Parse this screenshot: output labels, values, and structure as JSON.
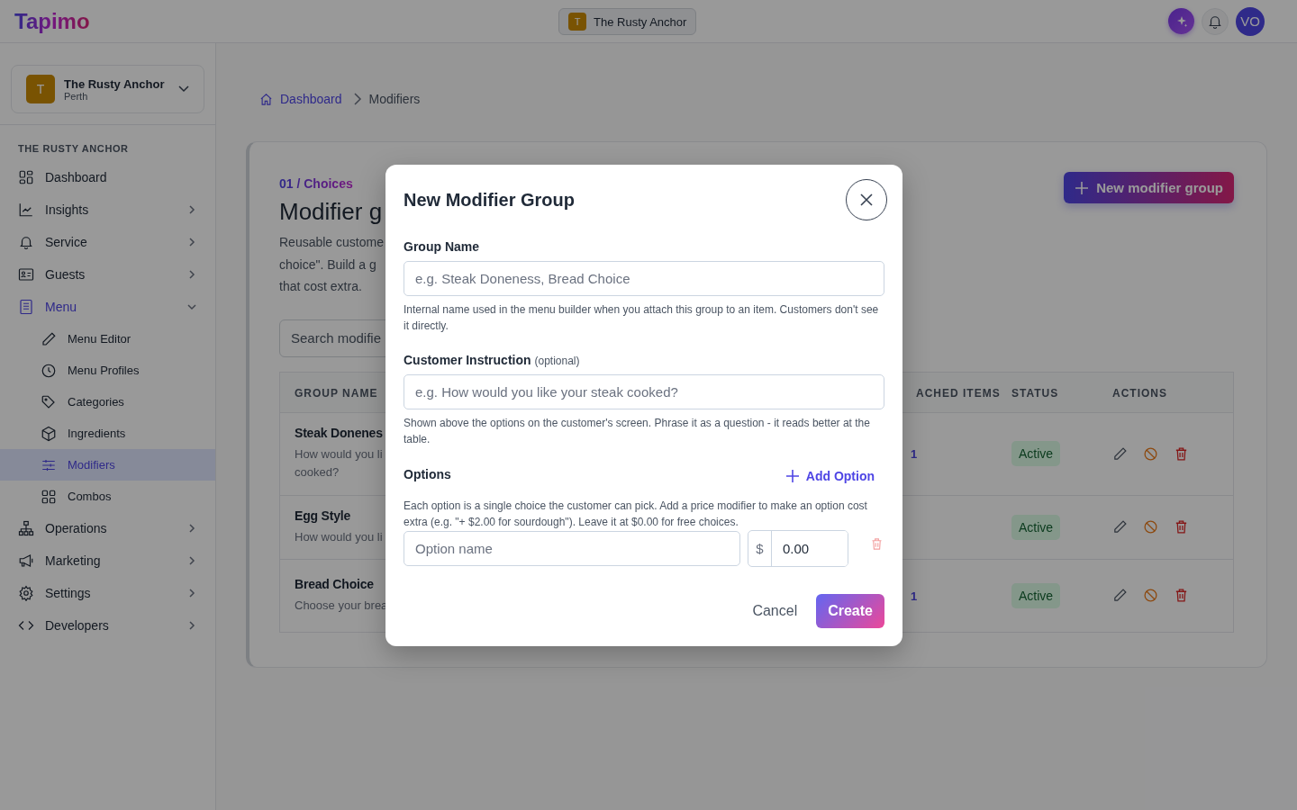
{
  "header": {
    "logo": "Tapimo",
    "venue": {
      "initial": "T",
      "name": "The Rusty Anchor"
    },
    "avatar": "VO"
  },
  "sidebar": {
    "venue": {
      "initial": "T",
      "name": "The Rusty Anchor",
      "location": "Perth"
    },
    "section": "THE RUSTY ANCHOR",
    "items": [
      {
        "label": "Dashboard",
        "selected": false
      },
      {
        "label": "Insights",
        "selected": false,
        "expanded": false
      },
      {
        "label": "Service",
        "selected": false,
        "expanded": false
      },
      {
        "label": "Guests",
        "selected": false,
        "expanded": false
      },
      {
        "label": "Menu",
        "selected": true,
        "expanded": true,
        "children": [
          {
            "label": "Menu Editor",
            "selected": false
          },
          {
            "label": "Menu Profiles",
            "selected": false
          },
          {
            "label": "Categories",
            "selected": false
          },
          {
            "label": "Ingredients",
            "selected": false
          },
          {
            "label": "Modifiers",
            "selected": true
          },
          {
            "label": "Combos",
            "selected": false
          }
        ]
      },
      {
        "label": "Operations",
        "selected": false,
        "expanded": false
      },
      {
        "label": "Marketing",
        "selected": false,
        "expanded": false
      },
      {
        "label": "Settings",
        "selected": false,
        "expanded": false
      },
      {
        "label": "Developers",
        "selected": false,
        "expanded": false
      }
    ]
  },
  "breadcrumb": [
    {
      "label": "Dashboard"
    },
    {
      "label": "Modifiers"
    }
  ],
  "page": {
    "eyebrow": "01 / Choices",
    "title": "Modifier g",
    "description_lines": [
      "Reusable custome",
      "choice\". Build a g",
      "that cost extra."
    ],
    "new_button": "New modifier group",
    "search_placeholder": "Search modifie"
  },
  "table": {
    "columns": [
      "GROUP NAME",
      "ACHED ITEMS",
      "STATUS",
      "ACTIONS"
    ],
    "rows": [
      {
        "name": "Steak Donenes",
        "instruction_lines": [
          "How would you li",
          "cooked?"
        ],
        "attached": "1",
        "status": "Active"
      },
      {
        "name": "Egg Style",
        "instruction_lines": [
          "How would you li"
        ],
        "status": "Active"
      },
      {
        "name": "Bread Choice",
        "instruction_lines": [
          "Choose your brea"
        ],
        "attached": "1",
        "status": "Active"
      }
    ]
  },
  "modal": {
    "title": "New Modifier Group",
    "group_name": {
      "label": "Group Name",
      "placeholder": "e.g. Steak Doneness, Bread Choice",
      "help": "Internal name used in the menu builder when you attach this group to an item. Customers don't see it directly."
    },
    "instruction": {
      "label": "Customer Instruction",
      "optional": "(optional)",
      "placeholder": "e.g. How would you like your steak cooked?",
      "help": "Shown above the options on the customer's screen. Phrase it as a question - it reads better at the table."
    },
    "options": {
      "label": "Options",
      "add_button": "Add Option",
      "help": "Each option is a single choice the customer can pick. Add a price modifier to make an option cost extra (e.g. \"+ $2.00 for sourdough\"). Leave it at $0.00 for free choices.",
      "rows": [
        {
          "placeholder": "Option name",
          "currency": "$",
          "price": "0.00"
        }
      ]
    },
    "cancel": "Cancel",
    "create": "Create"
  }
}
